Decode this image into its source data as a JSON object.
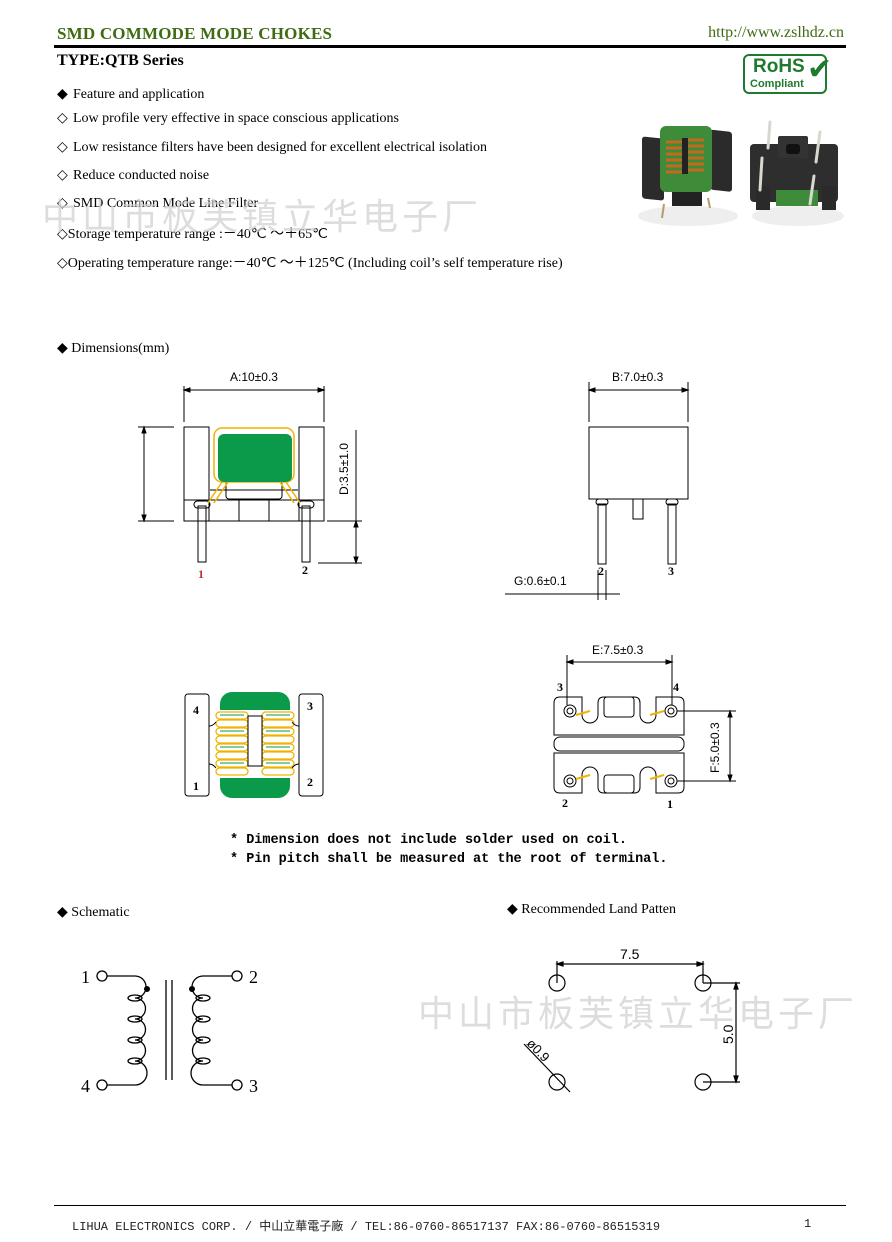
{
  "header": {
    "title": "SMD COMMODE MODE CHOKES",
    "url": "http://www.zslhdz.cn",
    "type": "TYPE:QTB Series"
  },
  "rohs": {
    "line1": "RoHS",
    "line2": "Compliant",
    "check": "✔",
    "color": "#1e7a2e"
  },
  "features": {
    "heading_bullet": "◆",
    "heading": "Feature and application",
    "items": [
      {
        "bullet": "◇",
        "text": "Low profile very effective in space conscious applications"
      },
      {
        "bullet": "◇",
        "text": "Low resistance filters have been designed for excellent electrical isolation"
      },
      {
        "bullet": "◇",
        "text": "Reduce conducted noise"
      },
      {
        "bullet": "◇",
        "text": "SMD Common Mode Line Filter"
      },
      {
        "bullet": "◇",
        "text": "Storage temperature range :－40℃ ～＋65℃"
      },
      {
        "bullet": "◇",
        "text": "Operating temperature range:－40℃ ～＋125℃ (Including coil’s self temperature rise)"
      }
    ]
  },
  "watermark": "中山市板芙镇立华电子厂",
  "dimensions": {
    "bullet": "◆",
    "heading": "Dimensions(mm)",
    "A": "A:10±0.3",
    "B": "B:7.0±0.3",
    "D": "D:3.5±1.0",
    "E": "E:7.5±0.3",
    "F": "F:5.0±0.3",
    "G": "G:0.6±0.1",
    "front_pins": [
      "1",
      "2"
    ],
    "side_pins": [
      "2",
      "3"
    ],
    "top_pins": [
      "4",
      "3",
      "1",
      "2"
    ],
    "bottom_pins": [
      "3",
      "4",
      "2",
      "1"
    ],
    "colors": {
      "core": "#0b9a4a",
      "wire": "#f0b400",
      "pin_label": "#e8a000"
    }
  },
  "notes": [
    "* Dimension does not include solder used on coil.",
    "* Pin pitch shall be measured at the root of terminal."
  ],
  "schematic": {
    "bullet": "◆",
    "heading": "Schematic",
    "pins": [
      "1",
      "2",
      "4",
      "3"
    ]
  },
  "land_pattern": {
    "bullet": "◆",
    "heading": "Recommended Land Patten",
    "pitch_x": "7.5",
    "pitch_y": "5.0",
    "hole": "ø0.9"
  },
  "footer": {
    "text": "LIHUA ELECTRONICS CORP. / 中山立華電子廠 / TEL:86-0760-86517137 FAX:86-0760-86515319",
    "page": "1"
  }
}
